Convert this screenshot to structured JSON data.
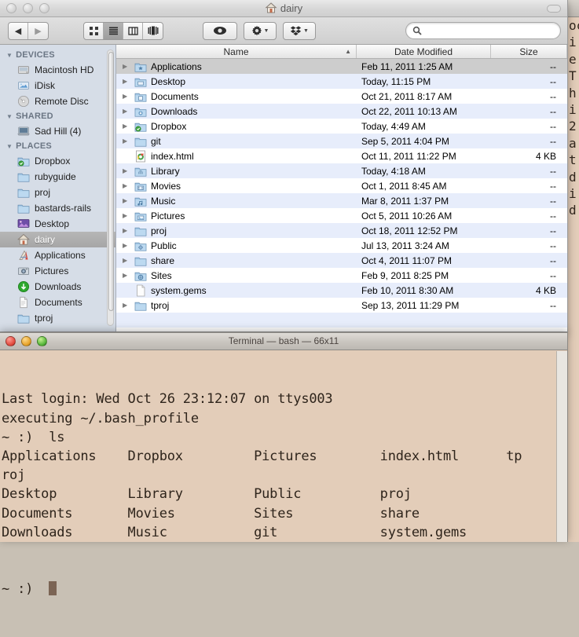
{
  "finder": {
    "window_title": "dairy",
    "title_icon": "home-icon",
    "traffic_lights": [
      "close",
      "minimize",
      "zoom"
    ],
    "toolbar": {
      "back_label": "◀",
      "forward_label": "▶",
      "view_modes": [
        {
          "name": "icon-view",
          "selected": false
        },
        {
          "name": "list-view",
          "selected": true
        },
        {
          "name": "column-view",
          "selected": false
        },
        {
          "name": "coverflow-view",
          "selected": false
        }
      ],
      "quicklook_label": "◉",
      "action_label": "gear-icon",
      "dropbox_label": "dropbox-icon",
      "search_placeholder": "",
      "search_value": ""
    },
    "sidebar": {
      "sections": [
        {
          "title": "DEVICES",
          "items": [
            {
              "label": "Macintosh HD",
              "icon": "harddisk-icon",
              "selected": false
            },
            {
              "label": "iDisk",
              "icon": "idisk-icon",
              "selected": false
            },
            {
              "label": "Remote Disc",
              "icon": "disc-icon",
              "selected": false
            }
          ]
        },
        {
          "title": "SHARED",
          "items": [
            {
              "label": "Sad Hill (4)",
              "icon": "computer-icon",
              "selected": false
            }
          ]
        },
        {
          "title": "PLACES",
          "items": [
            {
              "label": "Dropbox",
              "icon": "dropbox-folder-icon",
              "selected": false
            },
            {
              "label": "rubyguide",
              "icon": "folder-icon",
              "selected": false
            },
            {
              "label": "proj",
              "icon": "folder-icon",
              "selected": false
            },
            {
              "label": "bastards-rails",
              "icon": "folder-icon",
              "selected": false
            },
            {
              "label": "Desktop",
              "icon": "desktop-icon",
              "selected": false
            },
            {
              "label": "dairy",
              "icon": "home-icon",
              "selected": true
            },
            {
              "label": "Applications",
              "icon": "applications-icon",
              "selected": false
            },
            {
              "label": "Pictures",
              "icon": "pictures-icon",
              "selected": false
            },
            {
              "label": "Downloads",
              "icon": "downloads-icon",
              "selected": false
            },
            {
              "label": "Documents",
              "icon": "documents-icon",
              "selected": false
            },
            {
              "label": "tproj",
              "icon": "folder-icon",
              "selected": false
            }
          ]
        }
      ]
    },
    "file_list": {
      "columns": [
        {
          "label": "Name",
          "sorted": true,
          "sort_direction": "▲"
        },
        {
          "label": "Date Modified",
          "sorted": false,
          "sort_direction": ""
        },
        {
          "label": "Size",
          "sorted": false,
          "sort_direction": ""
        }
      ],
      "rows": [
        {
          "name": "Applications",
          "date": "Feb 11, 2011 1:25 AM",
          "size": "--",
          "icon": "applications-folder-icon",
          "expandable": true,
          "selected": true
        },
        {
          "name": "Desktop",
          "date": "Today, 11:15 PM",
          "size": "--",
          "icon": "desktop-folder-icon",
          "expandable": true,
          "selected": false
        },
        {
          "name": "Documents",
          "date": "Oct 21, 2011 8:17 AM",
          "size": "--",
          "icon": "documents-folder-icon",
          "expandable": true,
          "selected": false
        },
        {
          "name": "Downloads",
          "date": "Oct 22, 2011 10:13 AM",
          "size": "--",
          "icon": "downloads-folder-icon",
          "expandable": true,
          "selected": false
        },
        {
          "name": "Dropbox",
          "date": "Today, 4:49 AM",
          "size": "--",
          "icon": "dropbox-folder-icon",
          "expandable": true,
          "selected": false
        },
        {
          "name": "git",
          "date": "Sep 5, 2011 4:04 PM",
          "size": "--",
          "icon": "folder-icon",
          "expandable": true,
          "selected": false
        },
        {
          "name": "index.html",
          "date": "Oct 11, 2011 11:22 PM",
          "size": "4 KB",
          "icon": "chrome-html-icon",
          "expandable": false,
          "selected": false
        },
        {
          "name": "Library",
          "date": "Today, 4:18 AM",
          "size": "--",
          "icon": "library-folder-icon",
          "expandable": true,
          "selected": false
        },
        {
          "name": "Movies",
          "date": "Oct 1, 2011 8:45 AM",
          "size": "--",
          "icon": "movies-folder-icon",
          "expandable": true,
          "selected": false
        },
        {
          "name": "Music",
          "date": "Mar 8, 2011 1:37 PM",
          "size": "--",
          "icon": "music-folder-icon",
          "expandable": true,
          "selected": false
        },
        {
          "name": "Pictures",
          "date": "Oct 5, 2011 10:26 AM",
          "size": "--",
          "icon": "pictures-folder-icon",
          "expandable": true,
          "selected": false
        },
        {
          "name": "proj",
          "date": "Oct 18, 2011 12:52 PM",
          "size": "--",
          "icon": "folder-icon",
          "expandable": true,
          "selected": false
        },
        {
          "name": "Public",
          "date": "Jul 13, 2011 3:24 AM",
          "size": "--",
          "icon": "public-folder-icon",
          "expandable": true,
          "selected": false
        },
        {
          "name": "share",
          "date": "Oct 4, 2011 11:07 PM",
          "size": "--",
          "icon": "folder-icon",
          "expandable": true,
          "selected": false
        },
        {
          "name": "Sites",
          "date": "Feb 9, 2011 8:25 PM",
          "size": "--",
          "icon": "sites-folder-icon",
          "expandable": true,
          "selected": false
        },
        {
          "name": "system.gems",
          "date": "Feb 10, 2011 8:30 AM",
          "size": "4 KB",
          "icon": "plain-file-icon",
          "expandable": false,
          "selected": false
        },
        {
          "name": "tproj",
          "date": "Sep 13, 2011 11:29 PM",
          "size": "--",
          "icon": "folder-icon",
          "expandable": true,
          "selected": false
        }
      ]
    }
  },
  "terminal": {
    "window_title": "Terminal — bash — 66x11",
    "traffic_lights": [
      "close",
      "minimize",
      "zoom"
    ],
    "lines": [
      "Last login: Wed Oct 26 23:12:07 on ttys003",
      "executing ~/.bash_profile",
      "~ :)  ls",
      "Applications    Dropbox         Pictures        index.html      tp",
      "roj",
      "Desktop         Library         Public          proj",
      "Documents       Movies          Sites           share",
      "Downloads       Music           git             system.gems"
    ],
    "prompt": "~ :)  "
  },
  "background_terminal": {
    "lines": [
      "oc",
      "",
      "i",
      "e",
      "T",
      "",
      "h",
      "i",
      "2",
      "a",
      "t",
      "d",
      "",
      "",
      "i",
      "d"
    ]
  },
  "colors": {
    "finder_sidebar_bg": "#d6dde7",
    "row_alt": "#e7edfb",
    "row_selected": "#cdcdcd",
    "terminal_bg": "#e3cdb9",
    "terminal_fg": "#2e241b"
  }
}
